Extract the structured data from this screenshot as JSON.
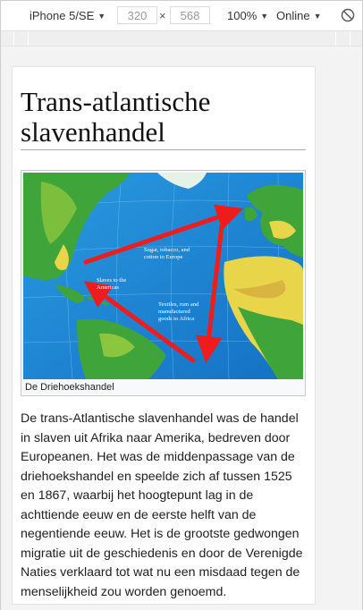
{
  "devtools": {
    "device": "iPhone 5/SE",
    "width": "320",
    "times": "×",
    "height": "568",
    "zoom": "100%",
    "network": "Online",
    "caret": "▼"
  },
  "article": {
    "title": "Trans-atlantische slavenhandel",
    "figure": {
      "caption": "De Driehoekshandel",
      "labels": {
        "europe": [
          "Sugar, tobacco, and",
          "cotton to Europe"
        ],
        "americas": [
          "Slaves to the",
          "Americas"
        ],
        "africa": [
          "Textiles, rum and",
          "manufactured",
          "goods to Africa"
        ]
      }
    },
    "paragraph": "De trans-Atlantische slavenhandel was de handel in slaven uit Afrika naar Amerika, bedreven door Europeanen. Het was de middenpassage van de driehoekshandel en speelde zich af tussen 1525 en 1867, waarbij het hoogtepunt lag in de achttiende eeuw en de eerste helft van de negentiende eeuw. Het is de grootste gedwongen migratie uit de geschiedenis en door de Verenigde Naties verklaard tot wat nu een misdaad tegen de menselijkheid zou worden genoemd."
  },
  "colors": {
    "arrow": "#ee1c1c",
    "ocean": "#1f8fd8",
    "land_green": "#3fa53a",
    "land_yellow": "#e8d54a"
  }
}
